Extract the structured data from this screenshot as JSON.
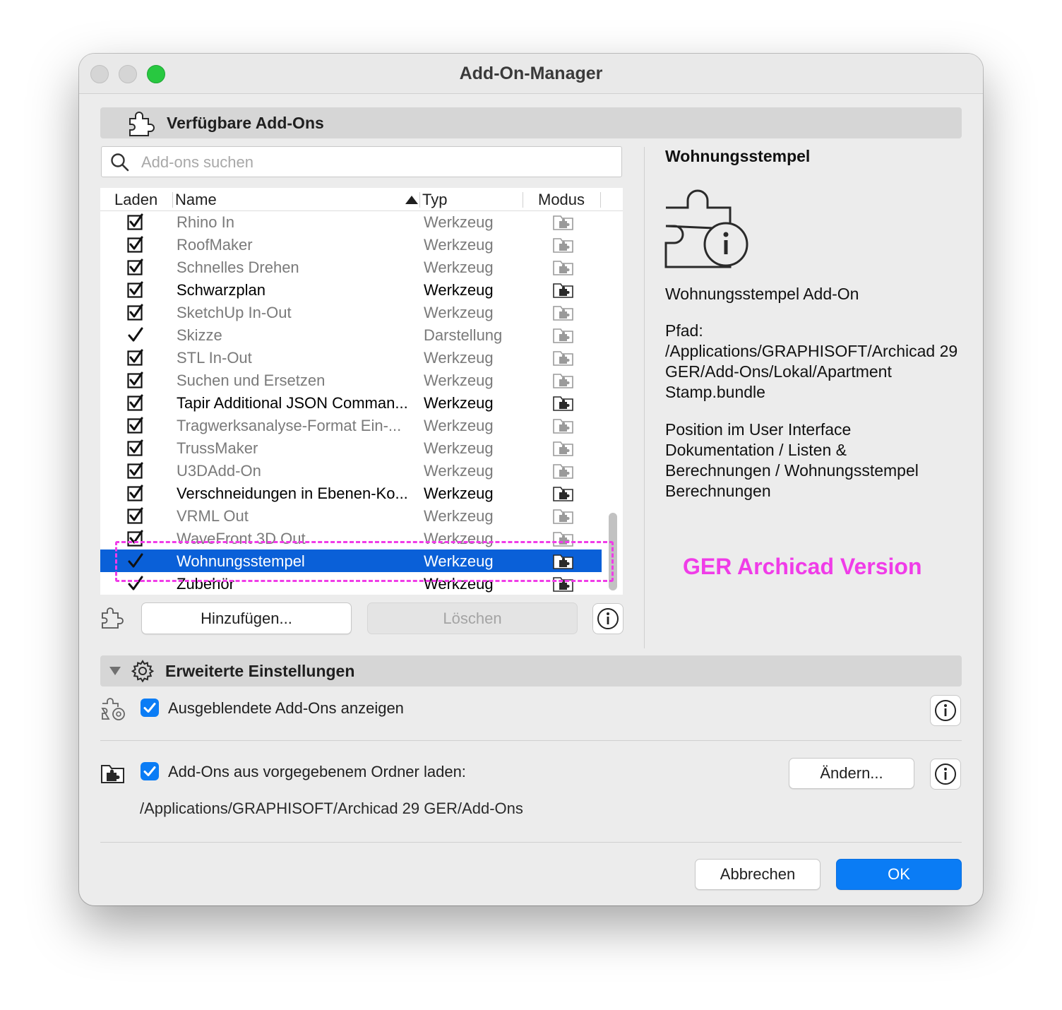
{
  "window": {
    "title": "Add-On-Manager"
  },
  "available": {
    "header": "Verfügbare Add-Ons",
    "search_placeholder": "Add-ons suchen",
    "columns": {
      "load": "Laden",
      "name": "Name",
      "type": "Typ",
      "mode": "Modus"
    },
    "rows": [
      {
        "name": "Rhino In",
        "type": "Werkzeug",
        "check": "box",
        "active": false
      },
      {
        "name": "RoofMaker",
        "type": "Werkzeug",
        "check": "box",
        "active": false
      },
      {
        "name": "Schnelles Drehen",
        "type": "Werkzeug",
        "check": "box",
        "active": false
      },
      {
        "name": "Schwarzplan",
        "type": "Werkzeug",
        "check": "box",
        "active": true
      },
      {
        "name": "SketchUp In-Out",
        "type": "Werkzeug",
        "check": "box",
        "active": false
      },
      {
        "name": "Skizze",
        "type": "Darstellung",
        "check": "tick",
        "active": false
      },
      {
        "name": "STL In-Out",
        "type": "Werkzeug",
        "check": "box",
        "active": false
      },
      {
        "name": "Suchen und Ersetzen",
        "type": "Werkzeug",
        "check": "box",
        "active": false
      },
      {
        "name": "Tapir Additional JSON Comman...",
        "type": "Werkzeug",
        "check": "box",
        "active": true
      },
      {
        "name": "Tragwerksanalyse-Format Ein-...",
        "type": "Werkzeug",
        "check": "box",
        "active": false
      },
      {
        "name": "TrussMaker",
        "type": "Werkzeug",
        "check": "box",
        "active": false
      },
      {
        "name": "U3DAdd-On",
        "type": "Werkzeug",
        "check": "box",
        "active": false
      },
      {
        "name": "Verschneidungen in Ebenen-Ko...",
        "type": "Werkzeug",
        "check": "box",
        "active": true
      },
      {
        "name": "VRML Out",
        "type": "Werkzeug",
        "check": "box",
        "active": false
      },
      {
        "name": "WaveFront 3D Out",
        "type": "Werkzeug",
        "check": "box",
        "active": false
      },
      {
        "name": "Wohnungsstempel",
        "type": "Werkzeug",
        "check": "tick",
        "active": true,
        "selected": true
      },
      {
        "name": "Zubehör",
        "type": "Werkzeug",
        "check": "tick",
        "active": true
      }
    ],
    "add_button": "Hinzufügen...",
    "delete_button": "Löschen"
  },
  "detail": {
    "title": "Wohnungsstempel",
    "description": "Wohnungsstempel Add-On",
    "path_label": "Pfad:",
    "path_value": "/Applications/GRAPHISOFT/Archicad 29 GER/Add-Ons/Lokal/Apartment Stamp.bundle",
    "position_label": "Position im User Interface",
    "position_value": "Dokumentation / Listen & Berechnungen / Wohnungsstempel Berechnungen",
    "annotation": "GER Archicad Version",
    "annotation_color": "#f03ce8"
  },
  "advanced": {
    "header": "Erweiterte Einstellungen",
    "show_hidden_label": "Ausgeblendete Add-Ons anzeigen",
    "show_hidden_checked": true,
    "folder_label": "Add-Ons aus vorgegebenem Ordner laden:",
    "folder_checked": true,
    "change_button": "Ändern...",
    "folder_path": "/Applications/GRAPHISOFT/Archicad 29 GER/Add-Ons"
  },
  "footer": {
    "cancel": "Abbrechen",
    "ok": "OK"
  },
  "colors": {
    "accent": "#0a7cf5",
    "selection": "#0a60d8",
    "maximize": "#28c840"
  }
}
